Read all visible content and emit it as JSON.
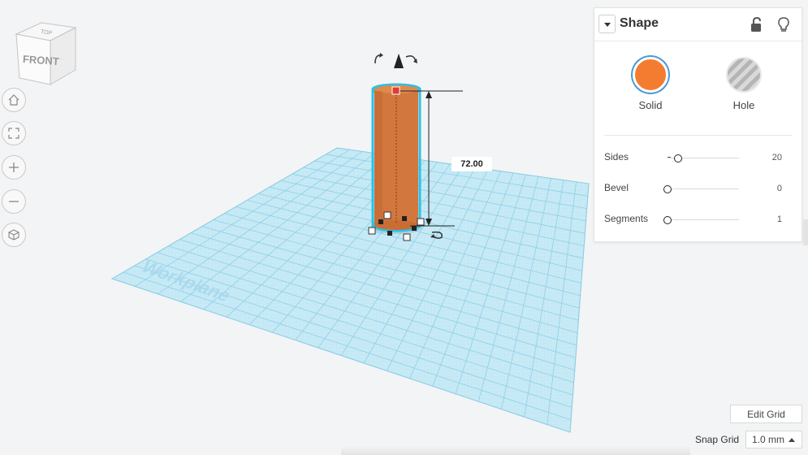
{
  "view_cube": {
    "top_label": "TOP",
    "front_label": "FRONT"
  },
  "nav_controls": [
    {
      "name": "home-view-button",
      "icon": "home-icon"
    },
    {
      "name": "fit-view-button",
      "icon": "fit-all-icon"
    },
    {
      "name": "zoom-in-button",
      "icon": "plus-icon"
    },
    {
      "name": "zoom-out-button",
      "icon": "minus-icon"
    },
    {
      "name": "perspective-button",
      "icon": "cube-icon"
    }
  ],
  "workplane": {
    "label": "Workplane",
    "grid_color": "#9fd6ea",
    "fill_color": "#c7eaf6"
  },
  "selected_shape": {
    "type": "cylinder",
    "color": "#d2773d",
    "outline_color": "#2bc0e8",
    "height_value": "72.00"
  },
  "shape_panel": {
    "title": "Shape",
    "solid_label": "Solid",
    "hole_label": "Hole",
    "solid_color": "#f47c30",
    "properties": [
      {
        "label": "Sides",
        "value": "20",
        "level": 0.15
      },
      {
        "label": "Bevel",
        "value": "0",
        "level": 0.0
      },
      {
        "label": "Segments",
        "value": "1",
        "level": 0.0
      }
    ]
  },
  "grid_controls": {
    "edit_grid_label": "Edit Grid",
    "snap_grid_label": "Snap Grid",
    "snap_grid_value": "1.0 mm"
  }
}
